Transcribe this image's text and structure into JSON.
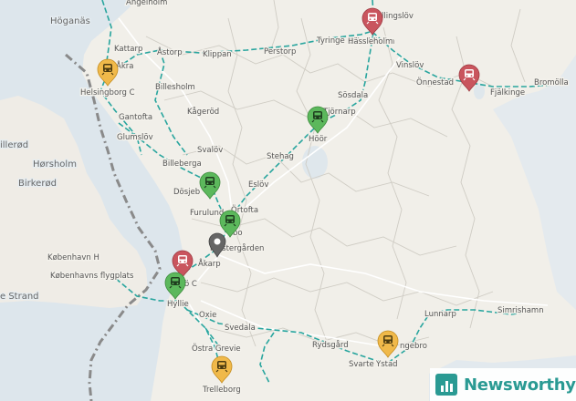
{
  "colors": {
    "pin_red": "#c9555e",
    "pin_green": "#5cb85c",
    "pin_yellow": "#f0b94a",
    "pin_grey": "#666666",
    "rail": "#28a59e",
    "water": "#dde6ec",
    "land": "#f1efe9",
    "brand": "#2a9a93"
  },
  "water_labels": [
    {
      "id": "hoganas",
      "text": "Höganäs"
    },
    {
      "id": "hillerod",
      "text": "illerød"
    },
    {
      "id": "horsholm",
      "text": "Hørsholm"
    },
    {
      "id": "birkerod",
      "text": "Birkerød"
    },
    {
      "id": "kobenhavn-h",
      "text": "København H"
    },
    {
      "id": "flygplats",
      "text": "Københavns flygplats"
    },
    {
      "id": "strand",
      "text": "e Strand"
    }
  ],
  "places": [
    {
      "id": "angelholm",
      "text": "Ängelholm"
    },
    {
      "id": "hassleholm-top",
      "text": "Hässleholm"
    },
    {
      "id": "kattarp",
      "text": "Kattarp"
    },
    {
      "id": "hjakra",
      "text": "Åkra"
    },
    {
      "id": "astorp",
      "text": "Åstorp"
    },
    {
      "id": "klippan",
      "text": "Klippan"
    },
    {
      "id": "perstorp",
      "text": "Perstorp"
    },
    {
      "id": "tyringe",
      "text": "Tyringe"
    },
    {
      "id": "vinslov",
      "text": "Vinslöv"
    },
    {
      "id": "onnestad",
      "text": "Önnestad"
    },
    {
      "id": "fjalkinge",
      "text": "Fjälkinge"
    },
    {
      "id": "bromolla",
      "text": "Bromölla"
    },
    {
      "id": "billesholm",
      "text": "Billesholm"
    },
    {
      "id": "sosdala",
      "text": "Sösdala"
    },
    {
      "id": "tjornarp",
      "text": "Tjörnarp"
    },
    {
      "id": "gantofta",
      "text": "Gantofta"
    },
    {
      "id": "kagerod",
      "text": "Kågeröd"
    },
    {
      "id": "glumslov",
      "text": "Glumslöv"
    },
    {
      "id": "svalov",
      "text": "Svalöv"
    },
    {
      "id": "billeberga",
      "text": "Billeberga"
    },
    {
      "id": "stehag",
      "text": "Stehag"
    },
    {
      "id": "dosjebro",
      "text": "Dösjeb"
    },
    {
      "id": "eslov",
      "text": "Eslöv"
    },
    {
      "id": "furulund",
      "text": "Furulund"
    },
    {
      "id": "ortofta",
      "text": "Örtofta"
    },
    {
      "id": "lundgarden",
      "text": "Klostergården"
    },
    {
      "id": "akarp",
      "text": "Åkarp"
    },
    {
      "id": "hyllie",
      "text": "Hyllie"
    },
    {
      "id": "oxie",
      "text": "Oxie"
    },
    {
      "id": "svedala",
      "text": "Svedala"
    },
    {
      "id": "ostra-grevie",
      "text": "Östra Grevie"
    },
    {
      "id": "rydsgard",
      "text": "Rydsgård"
    },
    {
      "id": "lunnarp",
      "text": "Lunnarp"
    },
    {
      "id": "simrishamn",
      "text": "Simrishamn"
    },
    {
      "id": "svarte",
      "text": "Svarte"
    },
    {
      "id": "ystad",
      "text": "Ystad"
    },
    {
      "id": "kopingebro",
      "text": "ngebro"
    },
    {
      "id": "trelleborg",
      "text": "Trelleborg"
    },
    {
      "id": "helsingborg",
      "text": "Helsingborg C"
    },
    {
      "id": "hoor",
      "text": "Höör"
    },
    {
      "id": "lundc",
      "text": "bo"
    },
    {
      "id": "malmoc",
      "text": "ö C"
    },
    {
      "id": "hassleholm-2",
      "text": "Hässleholm"
    },
    {
      "id": "tillingslov",
      "text": "llingslöv"
    }
  ],
  "markers": [
    {
      "id": "hassleholm",
      "color": "red",
      "icon": "train-icon"
    },
    {
      "id": "fjalkinge",
      "color": "red",
      "icon": "train-icon"
    },
    {
      "id": "helsingborg",
      "color": "yellow",
      "icon": "train-icon"
    },
    {
      "id": "hoor",
      "color": "green",
      "icon": "train-icon"
    },
    {
      "id": "dosjebro",
      "color": "green",
      "icon": "train-icon"
    },
    {
      "id": "lund",
      "color": "green",
      "icon": "train-icon"
    },
    {
      "id": "lund-location",
      "color": "grey",
      "icon": "location-icon"
    },
    {
      "id": "malmo",
      "color": "red",
      "icon": "train-icon"
    },
    {
      "id": "hyllie",
      "color": "green",
      "icon": "train-icon"
    },
    {
      "id": "ystad",
      "color": "yellow",
      "icon": "train-icon"
    },
    {
      "id": "trelleborg",
      "color": "yellow",
      "icon": "train-icon"
    }
  ],
  "brand": {
    "name": "Newsworthy",
    "icon": "bar-chart-icon"
  }
}
